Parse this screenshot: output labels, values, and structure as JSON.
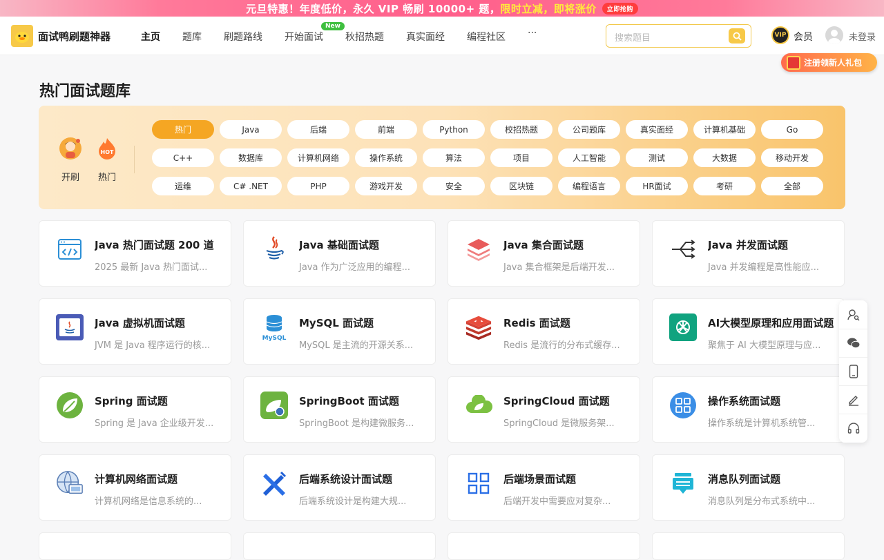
{
  "promo": {
    "part1": "元旦特惠！年度低价，永久 VIP 畅刷 10000+ 题，",
    "part2": "限时立减，即将涨价",
    "button": "立即抢购"
  },
  "header": {
    "brand": "面试鸭刷题神器",
    "menu": [
      "主页",
      "题库",
      "刷题路线",
      "开始面试",
      "秋招热题",
      "真实面经",
      "编程社区",
      "···"
    ],
    "new_badge": "New",
    "search_placeholder": "搜索题目",
    "vip_badge": "VIP",
    "vip_label": "会员",
    "login_label": "未登录",
    "gift_label": "注册领新人礼包"
  },
  "main": {
    "title": "热门面试题库",
    "quick": [
      {
        "label": "开刷",
        "icon": "avatar-icon"
      },
      {
        "label": "热门",
        "icon": "hot-icon"
      }
    ],
    "categories": [
      "热门",
      "Java",
      "后端",
      "前端",
      "Python",
      "校招热题",
      "公司题库",
      "真实面经",
      "计算机基础",
      "Go",
      "C++",
      "数据库",
      "计算机网络",
      "操作系统",
      "算法",
      "项目",
      "人工智能",
      "测试",
      "大数据",
      "移动开发",
      "运维",
      "C# .NET",
      "PHP",
      "游戏开发",
      "安全",
      "区块链",
      "编程语言",
      "HR面试",
      "考研",
      "全部"
    ],
    "active_category": "热门",
    "cards": [
      {
        "title": "Java 热门面试题 200 道",
        "desc": "2025 最新 Java 热门面试...",
        "icon": "code-window-icon"
      },
      {
        "title": "Java 基础面试题",
        "desc": "Java 作为广泛应用的编程...",
        "icon": "java-icon"
      },
      {
        "title": "Java 集合面试题",
        "desc": "Java 集合框架是后端开发...",
        "icon": "layers-icon"
      },
      {
        "title": "Java 并发面试题",
        "desc": "Java 并发编程是高性能应...",
        "icon": "fork-arrows-icon"
      },
      {
        "title": "Java 虚拟机面试题",
        "desc": "JVM 是 Java 程序运行的核...",
        "icon": "jvm-icon"
      },
      {
        "title": "MySQL 面试题",
        "desc": "MySQL 是主流的开源关系...",
        "icon": "mysql-icon"
      },
      {
        "title": "Redis 面试题",
        "desc": "Redis 是流行的分布式缓存...",
        "icon": "redis-icon"
      },
      {
        "title": "AI大模型原理和应用面试题",
        "desc": "聚焦于 AI 大模型原理与应...",
        "icon": "openai-icon"
      },
      {
        "title": "Spring 面试题",
        "desc": "Spring 是 Java 企业级开发...",
        "icon": "spring-leaf-icon"
      },
      {
        "title": "SpringBoot 面试题",
        "desc": "SpringBoot 是构建微服务...",
        "icon": "springboot-icon"
      },
      {
        "title": "SpringCloud 面试题",
        "desc": "SpringCloud 是微服务架...",
        "icon": "springcloud-icon"
      },
      {
        "title": "操作系统面试题",
        "desc": "操作系统是计算机系统管...",
        "icon": "os-grid-icon"
      },
      {
        "title": "计算机网络面试题",
        "desc": "计算机网络是信息系统的...",
        "icon": "network-globe-icon"
      },
      {
        "title": "后端系统设计面试题",
        "desc": "后端系统设计是构建大规...",
        "icon": "design-tools-icon"
      },
      {
        "title": "后端场景面试题",
        "desc": "后端开发中需要应对复杂...",
        "icon": "four-squares-icon"
      },
      {
        "title": "消息队列面试题",
        "desc": "消息队列是分布式系统中...",
        "icon": "message-queue-icon"
      }
    ]
  },
  "colors": {
    "accent": "#f7c948",
    "active_chip": "#f5a623",
    "promo": "#ff5e8a"
  }
}
